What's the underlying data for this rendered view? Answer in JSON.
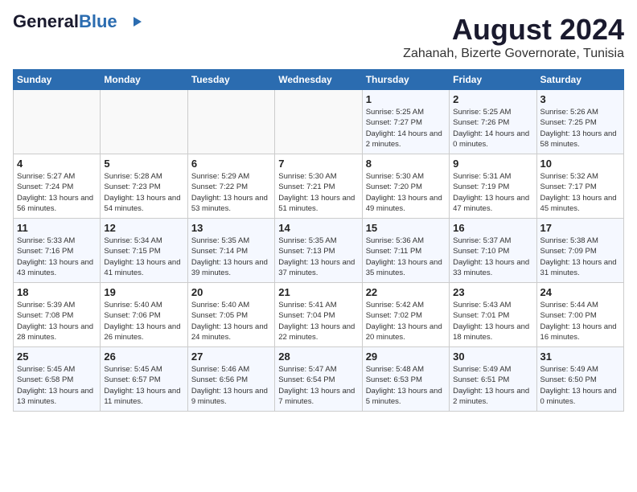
{
  "header": {
    "logo_line1": "General",
    "logo_line2": "Blue",
    "title": "August 2024",
    "subtitle": "Zahanah, Bizerte Governorate, Tunisia"
  },
  "weekdays": [
    "Sunday",
    "Monday",
    "Tuesday",
    "Wednesday",
    "Thursday",
    "Friday",
    "Saturday"
  ],
  "weeks": [
    [
      {
        "day": "",
        "content": ""
      },
      {
        "day": "",
        "content": ""
      },
      {
        "day": "",
        "content": ""
      },
      {
        "day": "",
        "content": ""
      },
      {
        "day": "1",
        "content": "Sunrise: 5:25 AM\nSunset: 7:27 PM\nDaylight: 14 hours\nand 2 minutes."
      },
      {
        "day": "2",
        "content": "Sunrise: 5:25 AM\nSunset: 7:26 PM\nDaylight: 14 hours\nand 0 minutes."
      },
      {
        "day": "3",
        "content": "Sunrise: 5:26 AM\nSunset: 7:25 PM\nDaylight: 13 hours\nand 58 minutes."
      }
    ],
    [
      {
        "day": "4",
        "content": "Sunrise: 5:27 AM\nSunset: 7:24 PM\nDaylight: 13 hours\nand 56 minutes."
      },
      {
        "day": "5",
        "content": "Sunrise: 5:28 AM\nSunset: 7:23 PM\nDaylight: 13 hours\nand 54 minutes."
      },
      {
        "day": "6",
        "content": "Sunrise: 5:29 AM\nSunset: 7:22 PM\nDaylight: 13 hours\nand 53 minutes."
      },
      {
        "day": "7",
        "content": "Sunrise: 5:30 AM\nSunset: 7:21 PM\nDaylight: 13 hours\nand 51 minutes."
      },
      {
        "day": "8",
        "content": "Sunrise: 5:30 AM\nSunset: 7:20 PM\nDaylight: 13 hours\nand 49 minutes."
      },
      {
        "day": "9",
        "content": "Sunrise: 5:31 AM\nSunset: 7:19 PM\nDaylight: 13 hours\nand 47 minutes."
      },
      {
        "day": "10",
        "content": "Sunrise: 5:32 AM\nSunset: 7:17 PM\nDaylight: 13 hours\nand 45 minutes."
      }
    ],
    [
      {
        "day": "11",
        "content": "Sunrise: 5:33 AM\nSunset: 7:16 PM\nDaylight: 13 hours\nand 43 minutes."
      },
      {
        "day": "12",
        "content": "Sunrise: 5:34 AM\nSunset: 7:15 PM\nDaylight: 13 hours\nand 41 minutes."
      },
      {
        "day": "13",
        "content": "Sunrise: 5:35 AM\nSunset: 7:14 PM\nDaylight: 13 hours\nand 39 minutes."
      },
      {
        "day": "14",
        "content": "Sunrise: 5:35 AM\nSunset: 7:13 PM\nDaylight: 13 hours\nand 37 minutes."
      },
      {
        "day": "15",
        "content": "Sunrise: 5:36 AM\nSunset: 7:11 PM\nDaylight: 13 hours\nand 35 minutes."
      },
      {
        "day": "16",
        "content": "Sunrise: 5:37 AM\nSunset: 7:10 PM\nDaylight: 13 hours\nand 33 minutes."
      },
      {
        "day": "17",
        "content": "Sunrise: 5:38 AM\nSunset: 7:09 PM\nDaylight: 13 hours\nand 31 minutes."
      }
    ],
    [
      {
        "day": "18",
        "content": "Sunrise: 5:39 AM\nSunset: 7:08 PM\nDaylight: 13 hours\nand 28 minutes."
      },
      {
        "day": "19",
        "content": "Sunrise: 5:40 AM\nSunset: 7:06 PM\nDaylight: 13 hours\nand 26 minutes."
      },
      {
        "day": "20",
        "content": "Sunrise: 5:40 AM\nSunset: 7:05 PM\nDaylight: 13 hours\nand 24 minutes."
      },
      {
        "day": "21",
        "content": "Sunrise: 5:41 AM\nSunset: 7:04 PM\nDaylight: 13 hours\nand 22 minutes."
      },
      {
        "day": "22",
        "content": "Sunrise: 5:42 AM\nSunset: 7:02 PM\nDaylight: 13 hours\nand 20 minutes."
      },
      {
        "day": "23",
        "content": "Sunrise: 5:43 AM\nSunset: 7:01 PM\nDaylight: 13 hours\nand 18 minutes."
      },
      {
        "day": "24",
        "content": "Sunrise: 5:44 AM\nSunset: 7:00 PM\nDaylight: 13 hours\nand 16 minutes."
      }
    ],
    [
      {
        "day": "25",
        "content": "Sunrise: 5:45 AM\nSunset: 6:58 PM\nDaylight: 13 hours\nand 13 minutes."
      },
      {
        "day": "26",
        "content": "Sunrise: 5:45 AM\nSunset: 6:57 PM\nDaylight: 13 hours\nand 11 minutes."
      },
      {
        "day": "27",
        "content": "Sunrise: 5:46 AM\nSunset: 6:56 PM\nDaylight: 13 hours\nand 9 minutes."
      },
      {
        "day": "28",
        "content": "Sunrise: 5:47 AM\nSunset: 6:54 PM\nDaylight: 13 hours\nand 7 minutes."
      },
      {
        "day": "29",
        "content": "Sunrise: 5:48 AM\nSunset: 6:53 PM\nDaylight: 13 hours\nand 5 minutes."
      },
      {
        "day": "30",
        "content": "Sunrise: 5:49 AM\nSunset: 6:51 PM\nDaylight: 13 hours\nand 2 minutes."
      },
      {
        "day": "31",
        "content": "Sunrise: 5:49 AM\nSunset: 6:50 PM\nDaylight: 13 hours\nand 0 minutes."
      }
    ]
  ]
}
